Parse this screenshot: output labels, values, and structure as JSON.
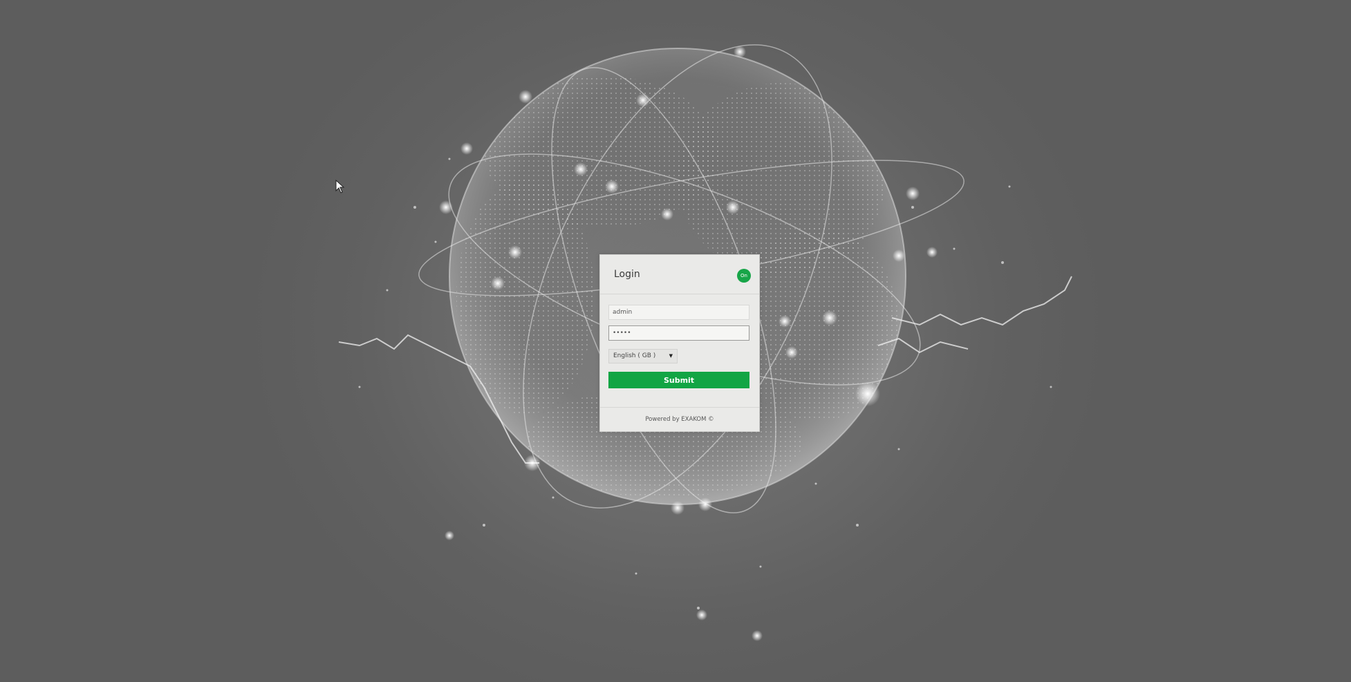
{
  "login": {
    "title": "Login",
    "status_badge": "On",
    "username_value": "admin",
    "password_value": "*****",
    "language_selected": "English ( GB )",
    "language_arrow": "▼",
    "submit_label": "Submit",
    "footer_text": "Powered by EXAKOM ©"
  },
  "colors": {
    "accent": "#12a544",
    "panel_bg": "#eaeae8",
    "page_bg": "#5f5f5f"
  },
  "icons": {
    "cursor": "mouse-pointer-icon",
    "select_arrow": "triangle-down-icon"
  }
}
